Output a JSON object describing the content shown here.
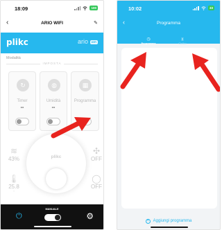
{
  "left_screen": {
    "status": {
      "time": "18:09",
      "battery": "100"
    },
    "nav": {
      "back": "‹",
      "title": "ARIO WIFI",
      "edit_icon": "✎"
    },
    "brand": {
      "logo": "plikc",
      "model": "ario",
      "model_badge": "WIFI"
    },
    "mode_label": "Modalità",
    "section_label": "IMPOSTA",
    "cards": [
      {
        "icon": "↻",
        "label": "Timer",
        "value": "--",
        "enabled": false
      },
      {
        "icon": "◍",
        "label": "Umidità",
        "value": "--",
        "enabled": false
      },
      {
        "icon": "▦",
        "label": "Programma",
        "value": "",
        "enabled": false
      }
    ],
    "humidity": {
      "icon": "≋",
      "value": "43%"
    },
    "temperature": {
      "icon": "🌡",
      "value": "25.8",
      "unit": "°"
    },
    "fan": {
      "icon": "✣",
      "value": "OFF"
    },
    "light": {
      "icon": "◯",
      "value": "OFF"
    },
    "knob_logo": "plikc",
    "bottom": {
      "power_icon": "⏻",
      "mode_label": "MANUALE",
      "manual_on": true,
      "settings_icon": "⚙"
    }
  },
  "right_screen": {
    "status": {
      "time": "10:02",
      "battery": "33"
    },
    "nav": {
      "back": "‹",
      "title": "Programma"
    },
    "tabs": [
      {
        "icon": "◷",
        "label": "Programma",
        "active": true
      },
      {
        "icon": "⧗",
        "label": "Ciclico",
        "active": false
      }
    ],
    "add_button": {
      "icon": "+",
      "label": "Aggiungi programma"
    }
  },
  "annotations": {
    "arrow_color": "#e8231e"
  },
  "colors": {
    "accent": "#26b8ee",
    "bottom_bar": "#111111",
    "arrow": "#e8231e"
  }
}
